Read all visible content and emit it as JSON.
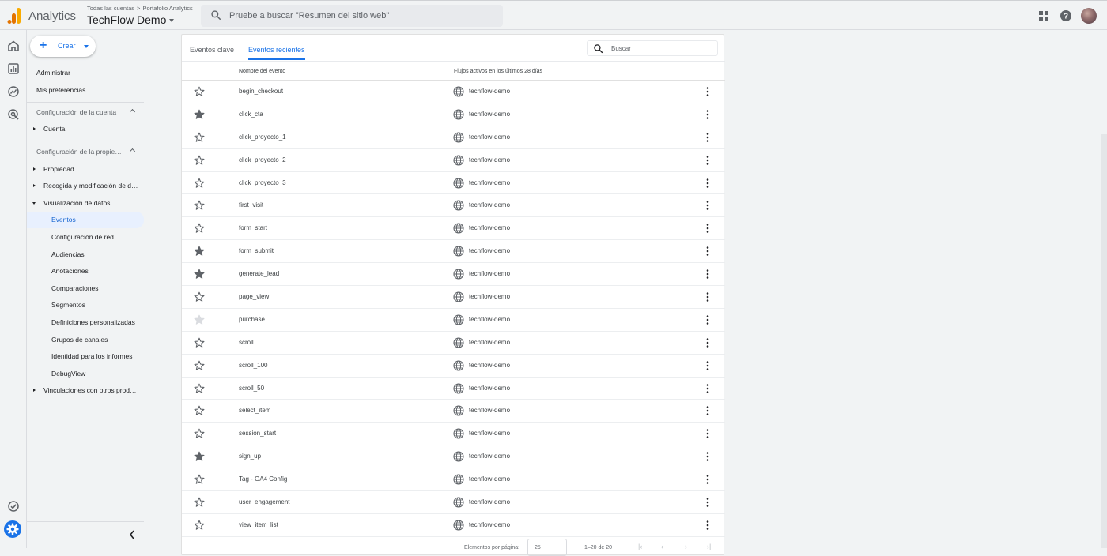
{
  "header": {
    "app_name": "Analytics",
    "breadcrumb": [
      "Todas las cuentas",
      ">",
      "Portafolio Analytics"
    ],
    "property_name": "TechFlow Demo",
    "search_placeholder": "Pruebe a buscar \"Resumen del sitio web\"",
    "icons": [
      "apps-grid-icon",
      "help-icon",
      "account-avatar"
    ]
  },
  "rail": {
    "icons": [
      "home-icon",
      "reports-icon",
      "explore-icon",
      "advertising-icon",
      "insights-check-icon",
      "admin-settings-icon"
    ]
  },
  "nav": {
    "create_label": "Crear",
    "items": [
      {
        "label": "Administrar",
        "type": "link"
      },
      {
        "label": "Mis preferencias",
        "type": "link"
      },
      {
        "label": "Configuración de la cuenta",
        "type": "section"
      },
      {
        "label": "Cuenta",
        "type": "tree"
      },
      {
        "label": "Configuración de la propiedad",
        "type": "section"
      },
      {
        "label": "Propiedad",
        "type": "tree"
      },
      {
        "label": "Recogida y modificación de datos",
        "type": "tree"
      },
      {
        "label": "Visualización de datos",
        "type": "tree-open"
      },
      {
        "label": "Eventos",
        "type": "child",
        "active": true
      },
      {
        "label": "Configuración de red",
        "type": "child"
      },
      {
        "label": "Audiencias",
        "type": "child"
      },
      {
        "label": "Anotaciones",
        "type": "child"
      },
      {
        "label": "Comparaciones",
        "type": "child"
      },
      {
        "label": "Segmentos",
        "type": "child"
      },
      {
        "label": "Definiciones personalizadas",
        "type": "child"
      },
      {
        "label": "Grupos de canales",
        "type": "child"
      },
      {
        "label": "Identidad para los informes",
        "type": "child"
      },
      {
        "label": "DebugView",
        "type": "child"
      },
      {
        "label": "Vinculaciones con otros productos",
        "type": "tree"
      }
    ]
  },
  "main": {
    "tabs": [
      {
        "label": "Eventos clave",
        "active": false
      },
      {
        "label": "Eventos recientes",
        "active": true
      }
    ],
    "search_placeholder": "Buscar",
    "columns": [
      "Nombre del evento",
      "Flujos activos en los últimos 28 días"
    ],
    "events": [
      {
        "name": "begin_checkout",
        "stream": "techflow-demo",
        "star": "outline"
      },
      {
        "name": "click_cta",
        "stream": "techflow-demo",
        "star": "filled"
      },
      {
        "name": "click_proyecto_1",
        "stream": "techflow-demo",
        "star": "outline"
      },
      {
        "name": "click_proyecto_2",
        "stream": "techflow-demo",
        "star": "outline"
      },
      {
        "name": "click_proyecto_3",
        "stream": "techflow-demo",
        "star": "outline"
      },
      {
        "name": "first_visit",
        "stream": "techflow-demo",
        "star": "outline"
      },
      {
        "name": "form_start",
        "stream": "techflow-demo",
        "star": "outline"
      },
      {
        "name": "form_submit",
        "stream": "techflow-demo",
        "star": "filled"
      },
      {
        "name": "generate_lead",
        "stream": "techflow-demo",
        "star": "filled"
      },
      {
        "name": "page_view",
        "stream": "techflow-demo",
        "star": "outline"
      },
      {
        "name": "purchase",
        "stream": "techflow-demo",
        "star": "disabled"
      },
      {
        "name": "scroll",
        "stream": "techflow-demo",
        "star": "outline"
      },
      {
        "name": "scroll_100",
        "stream": "techflow-demo",
        "star": "outline"
      },
      {
        "name": "scroll_50",
        "stream": "techflow-demo",
        "star": "outline"
      },
      {
        "name": "select_item",
        "stream": "techflow-demo",
        "star": "outline"
      },
      {
        "name": "session_start",
        "stream": "techflow-demo",
        "star": "outline"
      },
      {
        "name": "sign_up",
        "stream": "techflow-demo",
        "star": "filled"
      },
      {
        "name": "Tag - GA4 Config",
        "stream": "techflow-demo",
        "star": "outline"
      },
      {
        "name": "user_engagement",
        "stream": "techflow-demo",
        "star": "outline"
      },
      {
        "name": "view_item_list",
        "stream": "techflow-demo",
        "star": "outline"
      }
    ],
    "pager": {
      "label": "Elementos por página:",
      "page_size": "25",
      "range": "1–20 de 20"
    }
  },
  "colors": {
    "accent": "#1a73e8",
    "star_filled": "#5f6368",
    "star_disabled": "#dadce0",
    "logo_orange": "#f9ab00",
    "logo_dark_orange": "#e37400"
  }
}
